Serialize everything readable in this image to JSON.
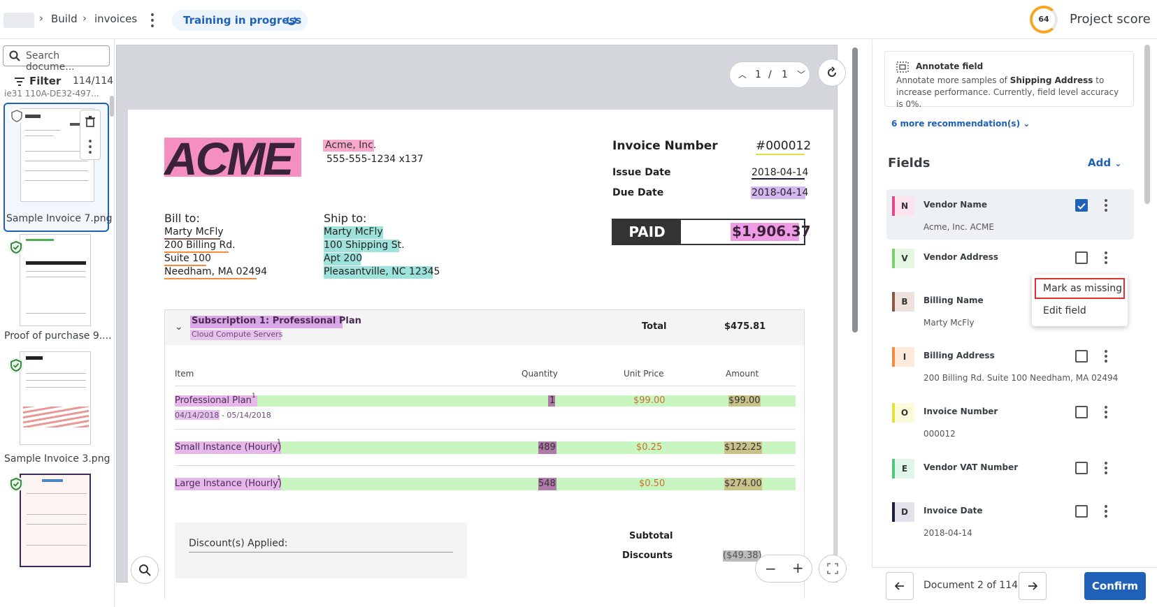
{
  "header": {
    "breadcrumb": [
      "Build",
      "invoices"
    ],
    "training_status": "Training in progress",
    "project_score_value": "64",
    "project_score_label": "Project score"
  },
  "left_panel": {
    "search_placeholder": "Search docume...",
    "filter_label": "Filter",
    "count": "114/114",
    "cut_label": "ie31 110A-DE32-497...",
    "documents": [
      {
        "label": "Sample Invoice 7.png",
        "selected": true
      },
      {
        "label": "Proof of purchase 9...."
      },
      {
        "label": "Sample Invoice 3.png"
      },
      {
        "label": ""
      }
    ]
  },
  "viewer": {
    "page_current": "1",
    "page_sep": "/",
    "page_total": "1"
  },
  "invoice": {
    "logo": "ACME",
    "vendor_name": "Acme, Inc.",
    "vendor_phone": "555-555-1234 x137",
    "invoice_number_label": "Invoice Number",
    "invoice_number": "#000012",
    "issue_date_label": "Issue Date",
    "issue_date": "2018-04-14",
    "due_date_label": "Due Date",
    "due_date": "2018-04-14",
    "paid_label": "PAID",
    "paid_amount": "$1,906.37",
    "bill_to_label": "Bill to:",
    "bill_to": [
      "Marty McFly",
      "200 Billing Rd.",
      "Suite 100",
      "Needham, MA 02494"
    ],
    "ship_to_label": "Ship to:",
    "ship_to": [
      "Marty McFly",
      "100 Shipping St.",
      "Apt 200",
      "Pleasantville, NC 12345"
    ],
    "subscription_title": "Subscription 1: Professional Plan",
    "subscription_sub": "Cloud Compute Servers",
    "total_label": "Total",
    "total_value": "$475.81",
    "table_headers": [
      "Item",
      "Quantity",
      "Unit Price",
      "Amount"
    ],
    "rows": [
      {
        "item": "Professional Plan",
        "sup": "1",
        "qty": "1",
        "price": "$99.00",
        "amount": "$99.00",
        "dates": "04/14/2018 - 05/14/2018"
      },
      {
        "item": "Small Instance (Hourly)",
        "sup": "1",
        "qty": "489",
        "price": "$0.25",
        "amount": "$122.25"
      },
      {
        "item": "Large Instance (Hourly)",
        "sup": "1",
        "qty": "548",
        "price": "$0.50",
        "amount": "$274.00"
      }
    ],
    "discount_label": "Discount(s) Applied:",
    "subtotal_label": "Subtotal",
    "discounts_label": "Discounts",
    "discounts_value": "($49.38)"
  },
  "right_panel": {
    "annotate_title": "Annotate field",
    "annotate_text_1": "Annotate more samples of ",
    "annotate_field": "Shipping Address",
    "annotate_text_2": " to increase performance. Currently, field level accuracy is 0%.",
    "more_recommendations": "6 more recommendation(s)",
    "fields_title": "Fields",
    "add_label": "Add",
    "fields": [
      {
        "badge": "N",
        "name": "Vendor Name",
        "value": "Acme, Inc. ACME",
        "checked": true,
        "color": "#e8458b",
        "bg": "#fde3ee"
      },
      {
        "badge": "V",
        "name": "Vendor Address",
        "value": "",
        "checked": false,
        "color": "#7bd06a",
        "bg": "#e6f7e1"
      },
      {
        "badge": "B",
        "name": "Billing Name",
        "value": "Marty McFly",
        "checked": false,
        "color": "#8a5a44",
        "bg": "#efe2dc"
      },
      {
        "badge": "I",
        "name": "Billing Address",
        "value": "200 Billing Rd. Suite 100 Needham, MA 02494",
        "checked": false,
        "color": "#f58b3c",
        "bg": "#feeadb"
      },
      {
        "badge": "O",
        "name": "Invoice Number",
        "value": "000012",
        "checked": false,
        "color": "#e6e13a",
        "bg": "#fbfbd9"
      },
      {
        "badge": "E",
        "name": "Vendor VAT Number",
        "value": "",
        "checked": false,
        "color": "#4cc77c",
        "bg": "#dff6e8"
      },
      {
        "badge": "D",
        "name": "Invoice Date",
        "value": "2018-04-14",
        "checked": false,
        "color": "#1b1f3b",
        "bg": "#e1e2ea"
      }
    ],
    "menu": [
      "Mark as missing",
      "Edit field"
    ],
    "doc_position": "Document 2 of 114",
    "confirm_label": "Confirm"
  }
}
